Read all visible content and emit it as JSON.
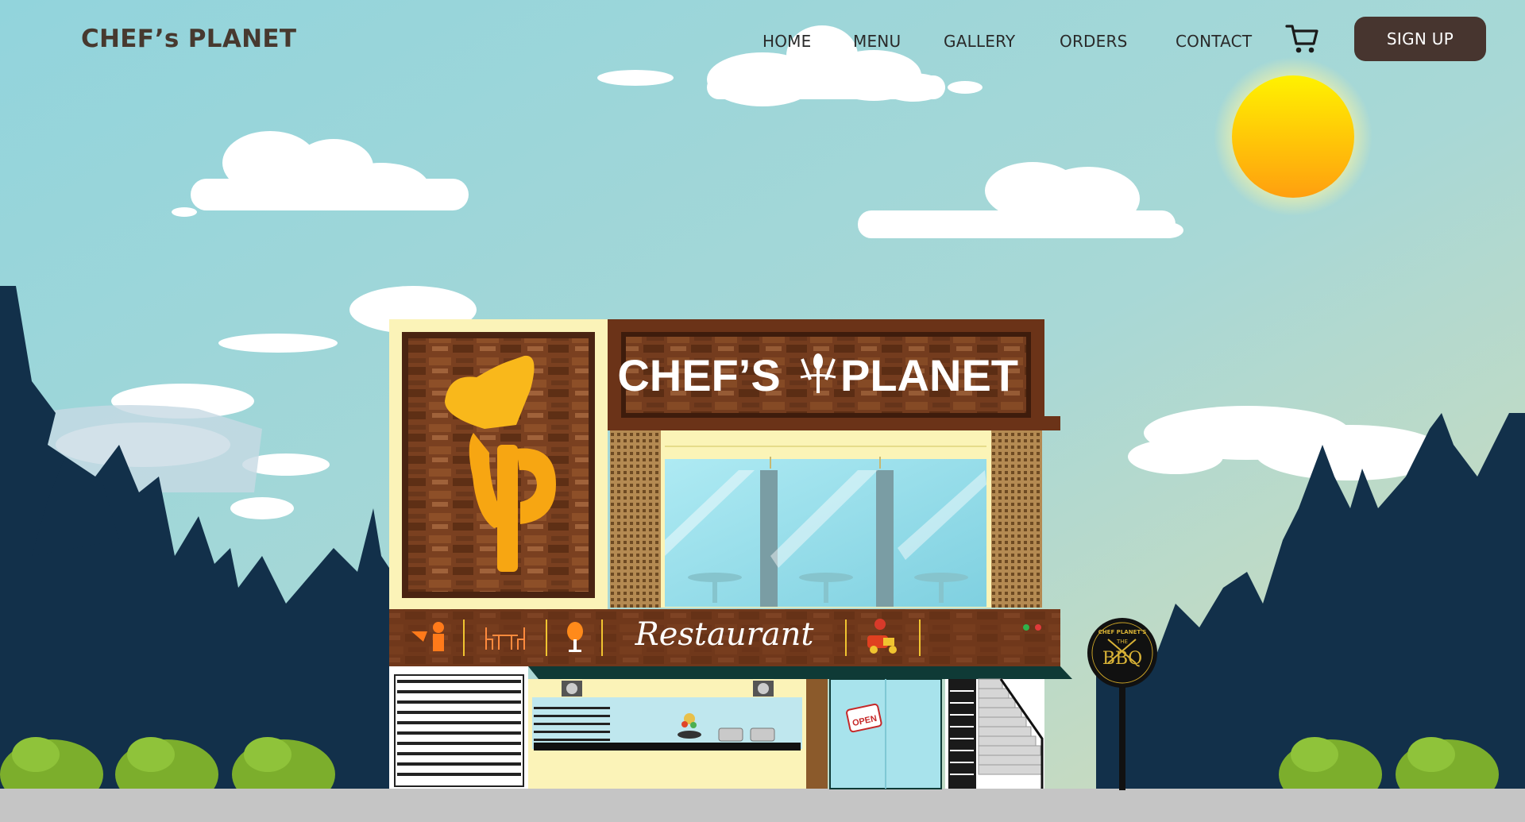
{
  "nav": {
    "brand": "CHEF’s PLANET",
    "links": [
      "HOME",
      "MENU",
      "GALLERY",
      "ORDERS",
      "CONTACT"
    ],
    "cart_icon": "shopping-cart-icon",
    "signup_label": "SIGN UP"
  },
  "storefront": {
    "sign_left": "CHEF’S",
    "sign_right": "PLANET",
    "sign_emblem": "fork-spoon-icon",
    "logo": "cp-logo",
    "band_label": "Restaurant",
    "band_icons": [
      "waiter-icon",
      "dining-table-icon",
      "ice-cream-icon",
      "delivery-scooter-icon"
    ],
    "open_sign": "OPEN",
    "bbq_sign": {
      "top": "CHEF PLANET'S",
      "middle": "THE",
      "bottom": "BBQ"
    }
  },
  "colors": {
    "nav_button": "#47352f",
    "brand_text": "#47392f",
    "sky": "#9fd6d9",
    "sun": "#ffc107",
    "wood": "#6b3318",
    "trees": "#12304a",
    "bushes": "#7cae2c"
  }
}
